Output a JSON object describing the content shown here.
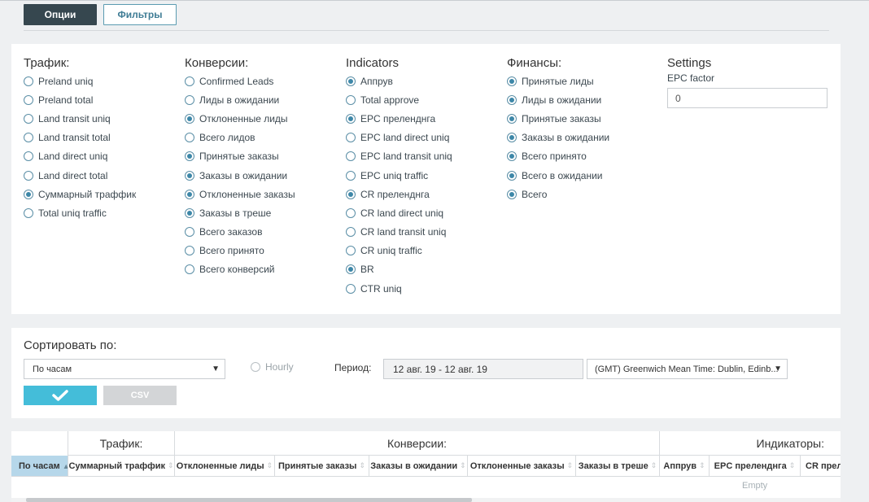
{
  "toolbar": {
    "options_label": "Опции",
    "filters_label": "Фильтры"
  },
  "traffic": {
    "title": "Трафик:",
    "items": [
      {
        "label": "Preland uniq",
        "checked": false
      },
      {
        "label": "Preland total",
        "checked": false
      },
      {
        "label": "Land transit uniq",
        "checked": false
      },
      {
        "label": "Land transit total",
        "checked": false
      },
      {
        "label": "Land direct uniq",
        "checked": false
      },
      {
        "label": "Land direct total",
        "checked": false
      },
      {
        "label": "Суммарный траффик",
        "checked": true
      },
      {
        "label": "Total uniq traffic",
        "checked": false
      }
    ]
  },
  "conversions": {
    "title": "Конверсии:",
    "items": [
      {
        "label": "Confirmed Leads",
        "checked": false
      },
      {
        "label": "Лиды в ожидании",
        "checked": false
      },
      {
        "label": "Отклоненные лиды",
        "checked": true
      },
      {
        "label": "Всего лидов",
        "checked": false
      },
      {
        "label": "Принятые заказы",
        "checked": true
      },
      {
        "label": "Заказы в ожидании",
        "checked": true
      },
      {
        "label": "Отклоненные заказы",
        "checked": true
      },
      {
        "label": "Заказы в треше",
        "checked": true
      },
      {
        "label": "Всего заказов",
        "checked": false
      },
      {
        "label": "Всего принято",
        "checked": false
      },
      {
        "label": "Всего конверсий",
        "checked": false
      }
    ]
  },
  "indicators": {
    "title": "Indicators",
    "items": [
      {
        "label": "Аппрув",
        "checked": true
      },
      {
        "label": "Total approve",
        "checked": false
      },
      {
        "label": "EPC преленднга",
        "checked": true
      },
      {
        "label": "EPC land direct uniq",
        "checked": false
      },
      {
        "label": "EPC land transit uniq",
        "checked": false
      },
      {
        "label": "EPC uniq traffic",
        "checked": false
      },
      {
        "label": "CR преленднга",
        "checked": true
      },
      {
        "label": "CR land direct uniq",
        "checked": false
      },
      {
        "label": "CR land transit uniq",
        "checked": false
      },
      {
        "label": "CR uniq traffic",
        "checked": false
      },
      {
        "label": "BR",
        "checked": true
      },
      {
        "label": "CTR uniq",
        "checked": false
      }
    ]
  },
  "finances": {
    "title": "Финансы:",
    "items": [
      {
        "label": "Принятые лиды",
        "checked": true
      },
      {
        "label": "Лиды в ожидании",
        "checked": true
      },
      {
        "label": "Принятые заказы",
        "checked": true
      },
      {
        "label": "Заказы в ожидании",
        "checked": true
      },
      {
        "label": "Всего принято",
        "checked": true
      },
      {
        "label": "Всего в ожидании",
        "checked": true
      },
      {
        "label": "Всего",
        "checked": true
      }
    ]
  },
  "settings": {
    "title": "Settings",
    "epc_label": "EPC factor",
    "epc_value": "0"
  },
  "sort": {
    "title": "Сортировать по:",
    "selected": "По часам",
    "hourly_label": "Hourly",
    "period_label": "Период:",
    "period_value": "12 авг. 19 - 12 авг. 19",
    "timezone": "(GMT) Greenwich Mean Time: Dublin, Edinb...",
    "csv_label": "CSV"
  },
  "table": {
    "groups": [
      "Трафик:",
      "Конверсии:",
      "Индикаторы:"
    ],
    "columns": [
      "По часам",
      "Суммарный траффик",
      "Отклоненные лиды",
      "Принятые заказы",
      "Заказы в ожидании",
      "Отклоненные заказы",
      "Заказы в треше",
      "Аппрув",
      "EPC преленднга",
      "CR прелен"
    ],
    "empty_text": "Empty"
  },
  "colors": {
    "accent": "#44bdd9",
    "dark": "#36474f",
    "radio": "#3d87a8",
    "active_header": "#b6d7ea"
  }
}
